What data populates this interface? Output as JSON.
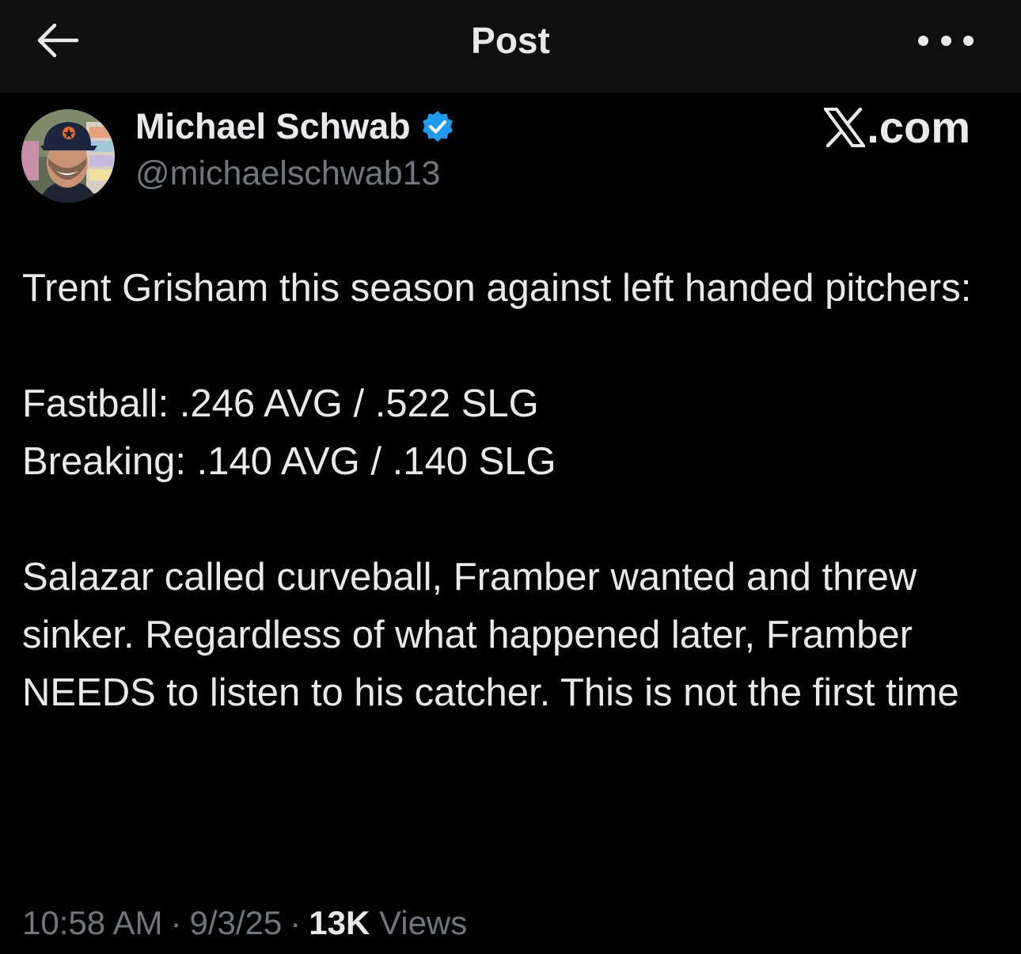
{
  "header": {
    "title": "Post",
    "back_icon": "arrow-left-icon",
    "more_icon": "more-horizontal-icon"
  },
  "author": {
    "display_name": "Michael Schwab",
    "handle": "@michaelschwab13",
    "verified": true,
    "verified_color": "#1d9bf0"
  },
  "watermark": {
    "logo": "x-logo-icon",
    "text": ".com"
  },
  "tweet": {
    "paragraph1": "Trent Grisham this season against left handed pitchers:",
    "line_fastball": "Fastball: .246 AVG / .522 SLG",
    "line_breaking": "Breaking: .140 AVG / .140 SLG",
    "paragraph3": "Salazar called curveball, Framber wanted and threw sinker. Regardless of what happened later, Framber NEEDS to listen to his catcher. This is not the first time"
  },
  "meta": {
    "time": "10:58 AM",
    "separator": "·",
    "date": "9/3/25",
    "views_count": "13K",
    "views_label": "Views"
  },
  "colors": {
    "background": "#000000",
    "header_background": "#0f0f0f",
    "primary_text": "#e7e9ea",
    "secondary_text": "#71767b"
  }
}
